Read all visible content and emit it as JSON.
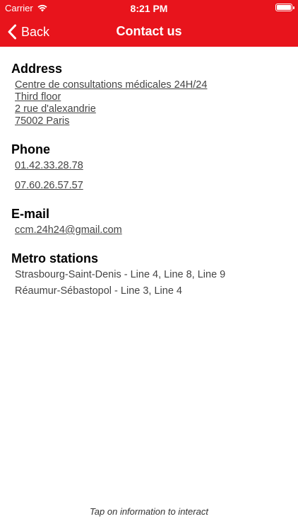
{
  "status_bar": {
    "carrier": "Carrier",
    "time": "8:21 PM"
  },
  "nav": {
    "back_label": "Back",
    "title": "Contact us",
    "header_color": "#e8141c"
  },
  "address": {
    "title": "Address",
    "lines": [
      "Centre de consultations médicales 24H/24",
      "Third floor",
      "2 rue d'alexandrie",
      "75002 Paris"
    ]
  },
  "phone": {
    "title": "Phone",
    "numbers": [
      "01.42.33.28.78",
      "07.60.26.57.57"
    ]
  },
  "email": {
    "title": "E-mail",
    "address": "ccm.24h24@gmail.com"
  },
  "metro": {
    "title": "Metro stations",
    "stations": [
      "Strasbourg-Saint-Denis - Line 4, Line 8, Line 9",
      "Réaumur-Sébastopol - Line 3, Line 4"
    ]
  },
  "footer": {
    "hint": "Tap on information to interact"
  }
}
